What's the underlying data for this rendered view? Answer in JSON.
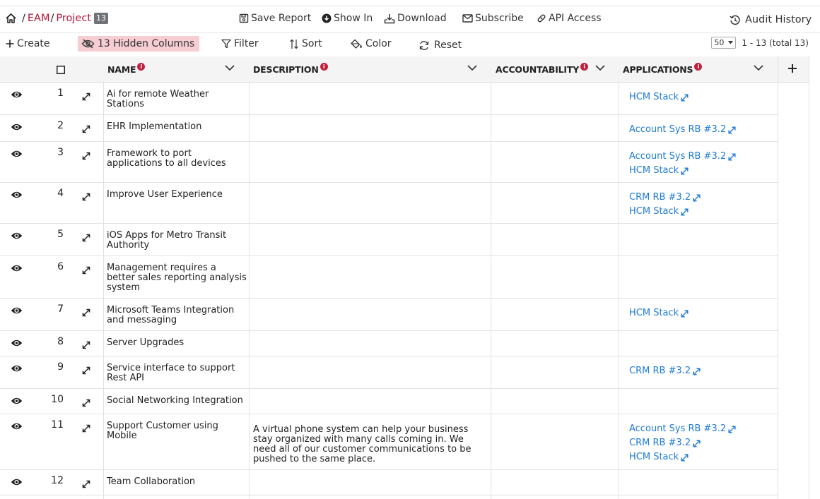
{
  "breadcrumb": {
    "items": [
      "EAM",
      "Project"
    ],
    "count": "13"
  },
  "topbar": {
    "save_report": "Save Report",
    "show_in": "Show In",
    "download": "Download",
    "subscribe": "Subscribe",
    "api_access": "API Access",
    "audit_history": "Audit History"
  },
  "toolbar": {
    "create": "Create",
    "hidden_columns": "13 Hidden Columns",
    "filter": "Filter",
    "sort": "Sort",
    "color": "Color",
    "reset": "Reset",
    "page_size": "50",
    "pagination": "1 - 13 (total 13)"
  },
  "columns": {
    "name": "NAME",
    "description": "DESCRIPTION",
    "accountability": "ACCOUNTABILITY",
    "applications": "APPLICATIONS"
  },
  "rows": [
    {
      "num": "1",
      "name": "Ai for remote Weather Stations",
      "description": "",
      "apps": [
        "HCM Stack"
      ]
    },
    {
      "num": "2",
      "name": "EHR Implementation",
      "description": "",
      "apps": [
        "Account Sys RB #3.2"
      ]
    },
    {
      "num": "3",
      "name": "Framework to port applications to all devices",
      "description": "",
      "apps": [
        "Account Sys RB #3.2",
        "HCM Stack"
      ]
    },
    {
      "num": "4",
      "name": "Improve User Experience",
      "description": "",
      "apps": [
        "CRM RB #3.2",
        "HCM Stack"
      ]
    },
    {
      "num": "5",
      "name": "iOS Apps for Metro Transit Authority",
      "description": "",
      "apps": []
    },
    {
      "num": "6",
      "name": "Management requires a better sales reporting analysis system",
      "description": "",
      "apps": []
    },
    {
      "num": "7",
      "name": "Microsoft Teams Integration and messaging",
      "description": "",
      "apps": [
        "HCM Stack"
      ]
    },
    {
      "num": "8",
      "name": "Server Upgrades",
      "description": "",
      "apps": []
    },
    {
      "num": "9",
      "name": "Service interface to support Rest API",
      "description": "",
      "apps": [
        "CRM RB #3.2"
      ]
    },
    {
      "num": "10",
      "name": "Social Networking Integration",
      "description": "",
      "apps": []
    },
    {
      "num": "11",
      "name": "Support Customer using Mobile",
      "description": "A virtual phone system can help your business stay organized with many calls coming in.  We need all of our customer communications to be pushed to the same place.",
      "apps": [
        "Account Sys RB #3.2",
        "CRM RB #3.2",
        "HCM Stack"
      ]
    },
    {
      "num": "12",
      "name": "Team Collaboration",
      "description": "",
      "apps": []
    }
  ]
}
